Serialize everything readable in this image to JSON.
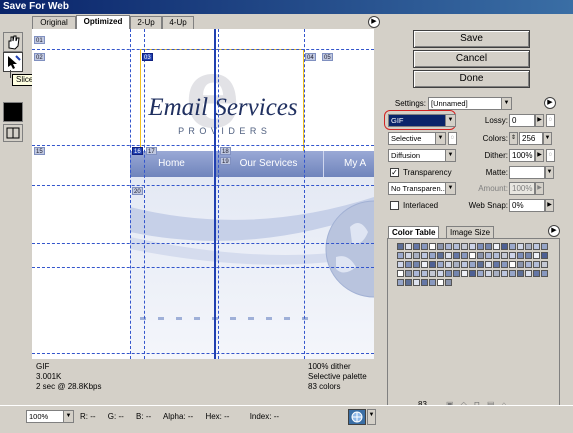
{
  "window": {
    "title": "Save For Web"
  },
  "tabs": [
    {
      "label": "Original"
    },
    {
      "label": "Optimized"
    },
    {
      "label": "2-Up"
    },
    {
      "label": "4-Up"
    }
  ],
  "tooltip": "Slice Select Tool (K)",
  "buttons": {
    "save": "Save",
    "cancel": "Cancel",
    "done": "Done"
  },
  "settings": {
    "label": "Settings:",
    "preset": "[Unnamed]",
    "format": "GIF",
    "reduction": "Selective",
    "dither_algorithm": "Diffusion",
    "transparency_label": "Transparency",
    "transparency_checked": true,
    "transparency_dither": "No Transparen...",
    "interlaced_label": "Interlaced",
    "interlaced_checked": false,
    "lossy_label": "Lossy:",
    "lossy_value": "0",
    "colors_label": "Colors:",
    "colors_value": "256",
    "dither_label": "Dither:",
    "dither_value": "100%",
    "matte_label": "Matte:",
    "amount_label": "Amount:",
    "amount_value": "100%",
    "websnap_label": "Web Snap:",
    "websnap_value": "0%"
  },
  "color_panel": {
    "tab_active": "Color Table",
    "tab_inactive": "Image Size",
    "count": "83"
  },
  "slices": [
    "01",
    "02",
    "03",
    "04",
    "05",
    "15",
    "16",
    "17",
    "18",
    "19",
    "20"
  ],
  "preview": {
    "brand_letter": "e",
    "brand_title": "Email Services",
    "brand_subtitle": "P R O V I D E R S",
    "nav": [
      "Home",
      "Our Services",
      "My A"
    ]
  },
  "info": {
    "format": "GIF",
    "size": "3.001K",
    "time": "2 sec @ 28.8Kbps",
    "dither": "100% dither",
    "palette": "Selective palette",
    "colors": "83 colors"
  },
  "statusbar": {
    "zoom": "100%",
    "r_label": "R:",
    "r_value": "--",
    "g_label": "G:",
    "g_value": "--",
    "b_label": "B:",
    "b_value": "--",
    "alpha_label": "Alpha:",
    "alpha_value": "--",
    "hex_label": "Hex:",
    "hex_value": "--",
    "index_label": "Index:",
    "index_value": "--"
  },
  "colors": {
    "title_bar": "#0a246a",
    "nav_bar": "#7f93c4",
    "slice_line": "#3355cc",
    "selected_slice": "#2040b0",
    "format_highlight": "#d22222"
  }
}
